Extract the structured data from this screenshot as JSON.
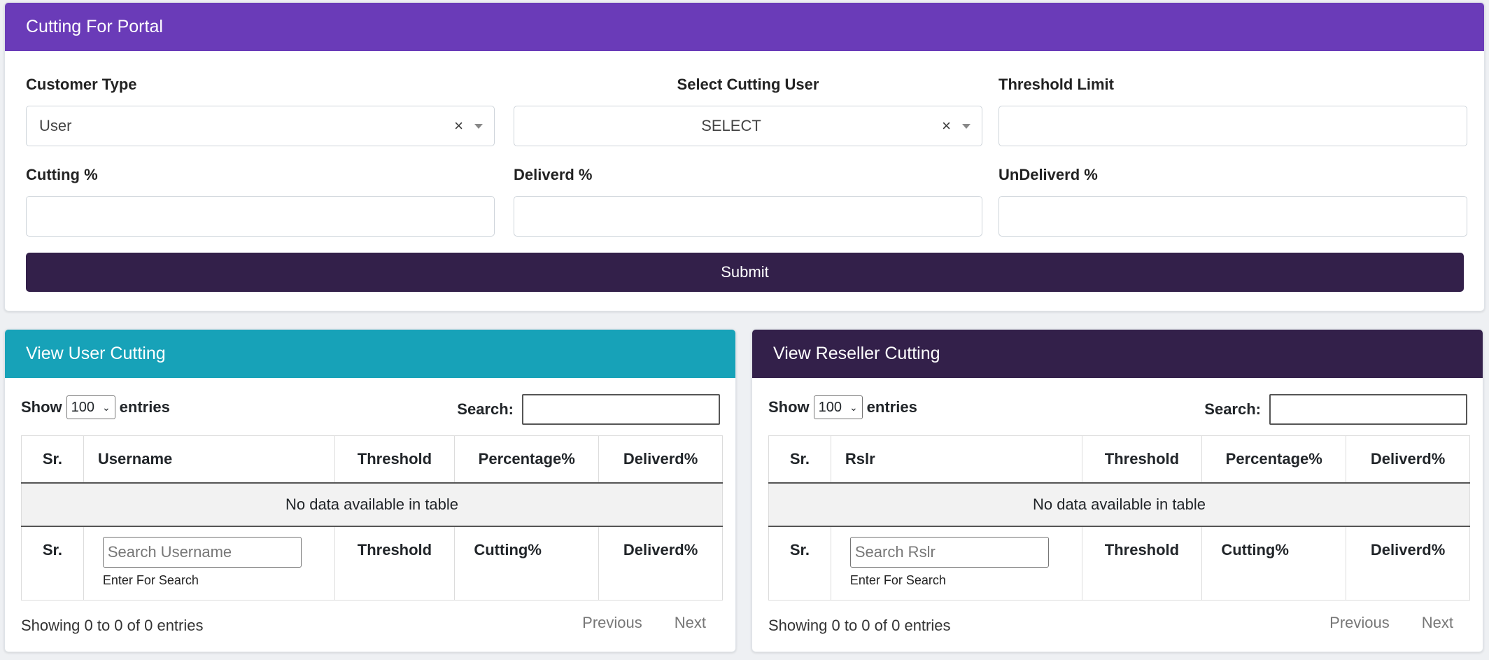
{
  "portal": {
    "title": "Cutting For Portal",
    "customer_type": {
      "label": "Customer Type",
      "value": "User",
      "clear": "×"
    },
    "cutting_user": {
      "label": "Select Cutting User",
      "value": "SELECT",
      "clear": "×"
    },
    "threshold": {
      "label": "Threshold Limit",
      "value": ""
    },
    "cutting_pct": {
      "label": "Cutting %",
      "value": ""
    },
    "deliverd_pct": {
      "label": "Deliverd %",
      "value": ""
    },
    "undeliverd_pct": {
      "label": "UnDeliverd %",
      "value": ""
    },
    "submit_label": "Submit"
  },
  "user_table": {
    "title": "View User Cutting",
    "show": "Show",
    "length_value": "100",
    "entries": "entries",
    "search_label": "Search:",
    "headers": [
      "Sr.",
      "Username",
      "Threshold",
      "Percentage%",
      "Deliverd%"
    ],
    "empty": "No data available in table",
    "footer": {
      "sr": "Sr.",
      "search_placeholder": "Search Username",
      "hint": "Enter For Search",
      "threshold": "Threshold",
      "cutting": "Cutting%",
      "deliverd": "Deliverd%"
    },
    "info": "Showing 0 to 0 of 0 entries",
    "previous": "Previous",
    "next": "Next"
  },
  "reseller_table": {
    "title": "View Reseller Cutting",
    "show": "Show",
    "length_value": "100",
    "entries": "entries",
    "search_label": "Search:",
    "headers": [
      "Sr.",
      "Rslr",
      "Threshold",
      "Percentage%",
      "Deliverd%"
    ],
    "empty": "No data available in table",
    "footer": {
      "sr": "Sr.",
      "search_placeholder": "Search Rslr",
      "hint": "Enter For Search",
      "threshold": "Threshold",
      "cutting": "Cutting%",
      "deliverd": "Deliverd%"
    },
    "info": "Showing 0 to 0 of 0 entries",
    "previous": "Previous",
    "next": "Next"
  },
  "colors": {
    "portal_header": "#6a3bb8",
    "user_header": "#17a2b8",
    "reseller_header": "#33204a",
    "submit": "#33204a"
  }
}
